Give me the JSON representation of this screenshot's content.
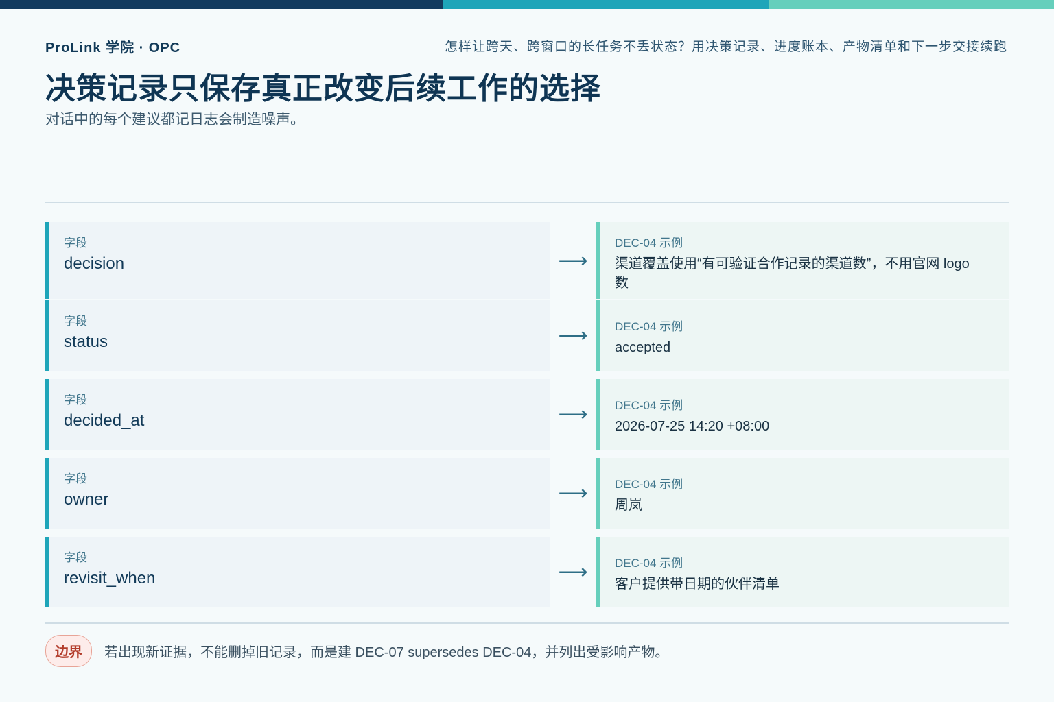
{
  "brand": "ProLink 学院 · OPC",
  "question": "怎样让跨天、跨窗口的长任务不丢状态？用决策记录、进度账本、产物清单和下一步交接续跑",
  "title": "决策记录只保存真正改变后续工作的选择",
  "subtitle": "对话中的每个建议都记日志会制造噪声。",
  "colors": {
    "primary": "#123a5e",
    "teal": "#1ea5b9",
    "mint": "#66cfbc",
    "warn": "#b23b2a"
  },
  "arrow_icon": "arrow-right-icon",
  "rows": [
    {
      "field_tag": "字段",
      "field": "decision",
      "example_tag": "DEC-04 示例",
      "example": "渠道覆盖使用“有可验证合作记录的渠道数”，不用官网 logo 数"
    },
    {
      "field_tag": "字段",
      "field": "status",
      "example_tag": "DEC-04 示例",
      "example": "accepted"
    },
    {
      "field_tag": "字段",
      "field": "decided_at",
      "example_tag": "DEC-04 示例",
      "example": "2026-07-25 14:20 +08:00"
    },
    {
      "field_tag": "字段",
      "field": "owner",
      "example_tag": "DEC-04 示例",
      "example": "周岚"
    },
    {
      "field_tag": "字段",
      "field": "revisit_when",
      "example_tag": "DEC-04 示例",
      "example": "客户提供带日期的伙伴清单"
    }
  ],
  "boundary": {
    "label": "边界",
    "text": "若出现新证据，不能删掉旧记录，而是建 DEC-07 supersedes DEC-04，并列出受影响产物。"
  }
}
